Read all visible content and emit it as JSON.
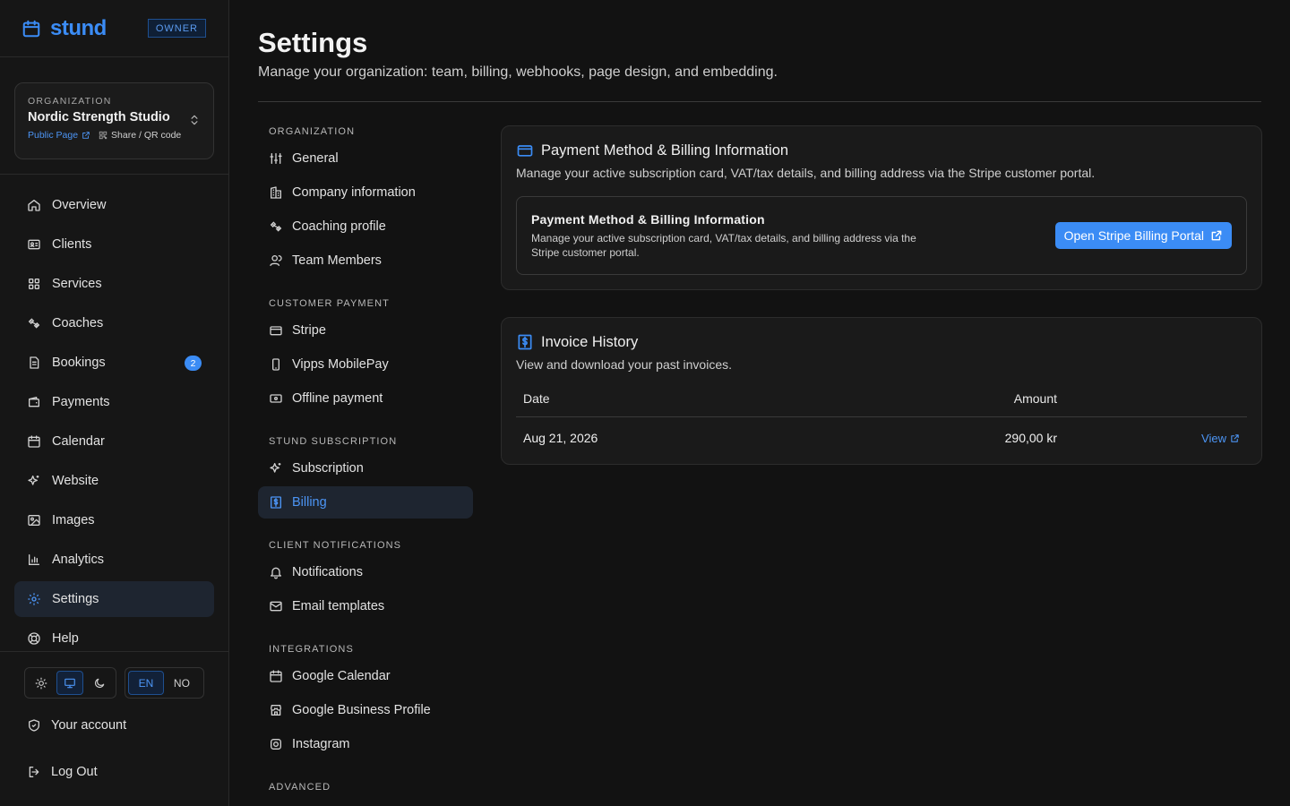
{
  "brand": {
    "name": "stund",
    "role_badge": "OWNER"
  },
  "organization": {
    "label": "ORGANIZATION",
    "name": "Nordic Strength Studio",
    "public_page_label": "Public Page",
    "share_label": "Share / QR code"
  },
  "sidebar": {
    "items": [
      {
        "label": "Overview",
        "icon": "home-icon"
      },
      {
        "label": "Clients",
        "icon": "id-card-icon"
      },
      {
        "label": "Services",
        "icon": "grid-icon"
      },
      {
        "label": "Coaches",
        "icon": "dumbbell-icon"
      },
      {
        "label": "Bookings",
        "icon": "document-icon",
        "badge": "2"
      },
      {
        "label": "Payments",
        "icon": "wallet-icon"
      },
      {
        "label": "Calendar",
        "icon": "calendar-icon"
      },
      {
        "label": "Website",
        "icon": "sparkles-icon"
      },
      {
        "label": "Images",
        "icon": "image-icon"
      },
      {
        "label": "Analytics",
        "icon": "bar-chart-icon"
      },
      {
        "label": "Settings",
        "icon": "gear-icon",
        "active": true
      },
      {
        "label": "Help",
        "icon": "lifebuoy-icon"
      }
    ],
    "theme": {
      "options": [
        "light",
        "system",
        "dark"
      ],
      "selected": "system"
    },
    "language": {
      "options": [
        "EN",
        "NO"
      ],
      "selected": "EN"
    },
    "account_label": "Your account",
    "logout_label": "Log Out"
  },
  "page": {
    "title": "Settings",
    "subtitle": "Manage your organization: team, billing, webhooks, page design, and embedding."
  },
  "settings_nav": {
    "sections": [
      {
        "title": "ORGANIZATION",
        "items": [
          "General",
          "Company information",
          "Coaching profile",
          "Team Members"
        ]
      },
      {
        "title": "CUSTOMER PAYMENT",
        "items": [
          "Stripe",
          "Vipps MobilePay",
          "Offline payment"
        ]
      },
      {
        "title": "STUND SUBSCRIPTION",
        "items": [
          "Subscription",
          "Billing"
        ]
      },
      {
        "title": "CLIENT NOTIFICATIONS",
        "items": [
          "Notifications",
          "Email templates"
        ]
      },
      {
        "title": "INTEGRATIONS",
        "items": [
          "Google Calendar",
          "Google Business Profile",
          "Instagram"
        ]
      },
      {
        "title": "ADVANCED",
        "items": []
      }
    ],
    "active_item": "Billing"
  },
  "billing_card": {
    "title": "Payment Method & Billing Information",
    "description": "Manage your active subscription card, VAT/tax details, and billing address via the Stripe customer portal.",
    "inner_title": "Payment Method & Billing Information",
    "inner_description": "Manage your active subscription card, VAT/tax details, and billing address via the Stripe customer portal.",
    "button_label": "Open Stripe Billing Portal"
  },
  "invoice_card": {
    "title": "Invoice History",
    "description": "View and download your past invoices.",
    "columns": [
      "Date",
      "Amount"
    ],
    "rows": [
      {
        "date": "Aug 21, 2026",
        "amount": "290,00 kr",
        "action": "View"
      }
    ]
  },
  "colors": {
    "accent": "#3b8cf5",
    "background": "#121212",
    "card": "#1a1a1a"
  }
}
